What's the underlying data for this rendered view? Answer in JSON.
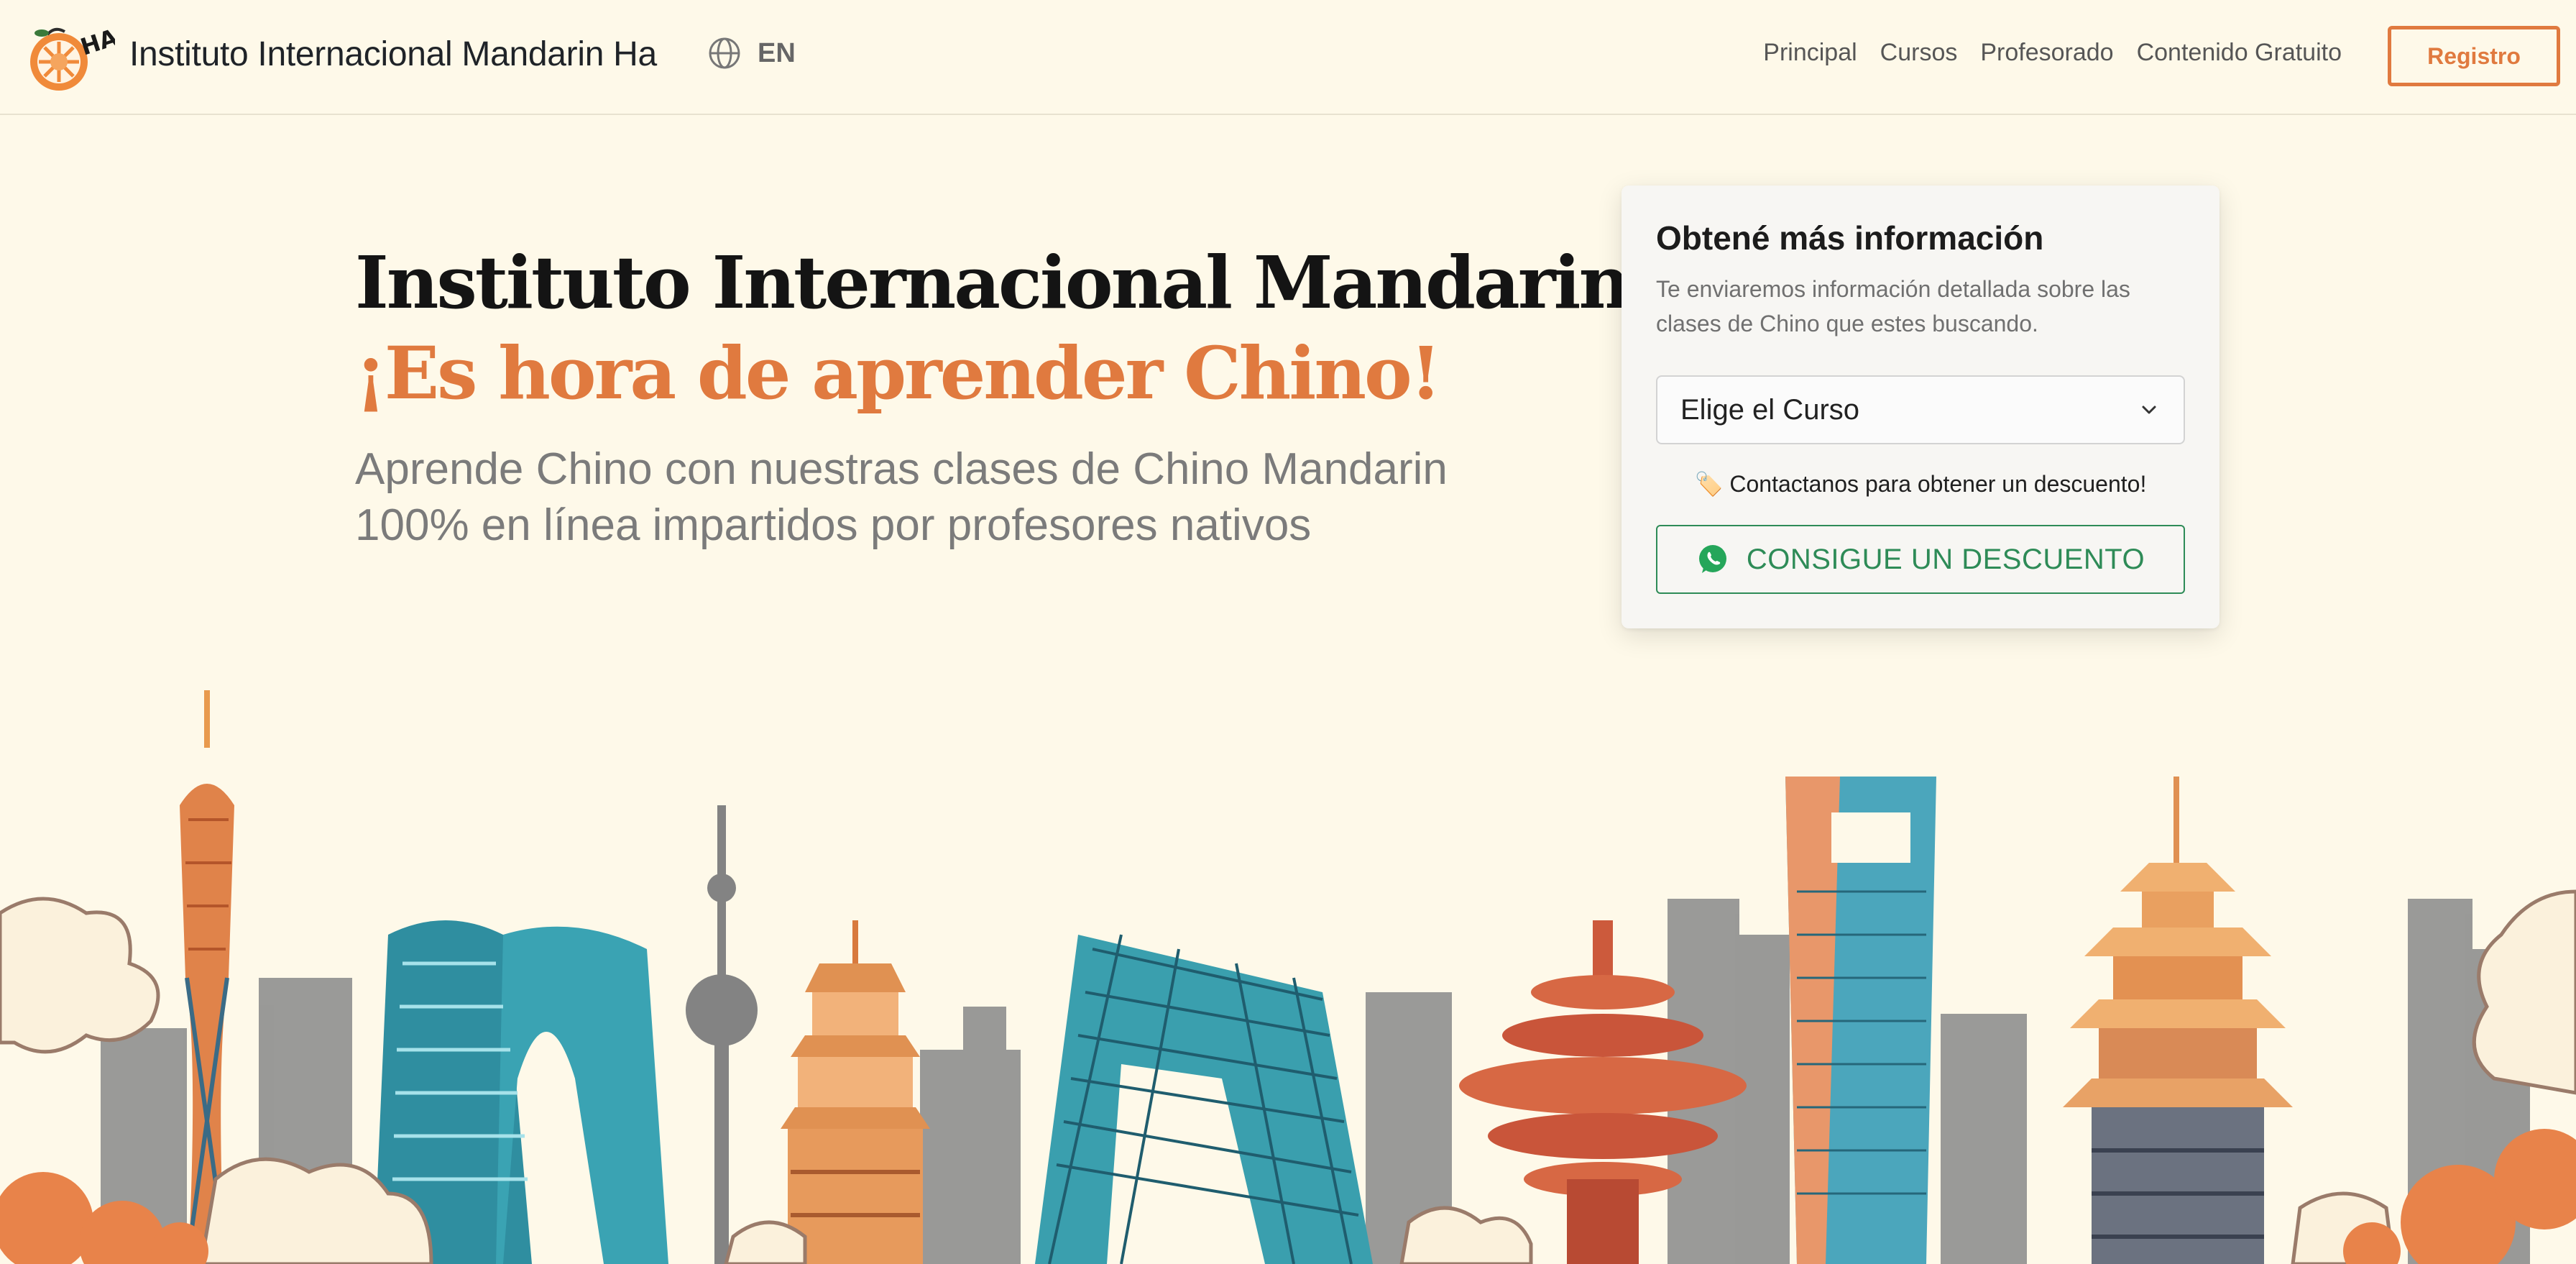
{
  "header": {
    "brand": "Instituto Internacional Mandarin Ha",
    "logo_mark_text": "HA!",
    "language": "EN",
    "nav": [
      "Principal",
      "Cursos",
      "Profesorado",
      "Contenido Gratuito"
    ],
    "register_label": "Registro"
  },
  "hero": {
    "title_line1": "Instituto Internacional Mandarin Ha,",
    "title_line2": "¡Es hora de aprender Chino!",
    "subtitle": "Aprende Chino con nuestras clases de Chino Mandarin 100% en línea impartidos por profesores nativos"
  },
  "card": {
    "title": "Obtené más información",
    "description": "Te enviaremos información detallada sobre las clases de Chino que estes buscando.",
    "select_value": "Elige el Curso",
    "discount_note": "🏷️ Contactanos para obtener un descuento!",
    "button_label": "CONSIGUE UN DESCUENTO"
  },
  "colors": {
    "background": "#fef9e9",
    "accent_orange": "#e07a3f",
    "whatsapp_green": "#2e8b57"
  },
  "icons": [
    "logo-mark-icon",
    "globe-icon",
    "chevron-down-icon",
    "whatsapp-icon"
  ]
}
